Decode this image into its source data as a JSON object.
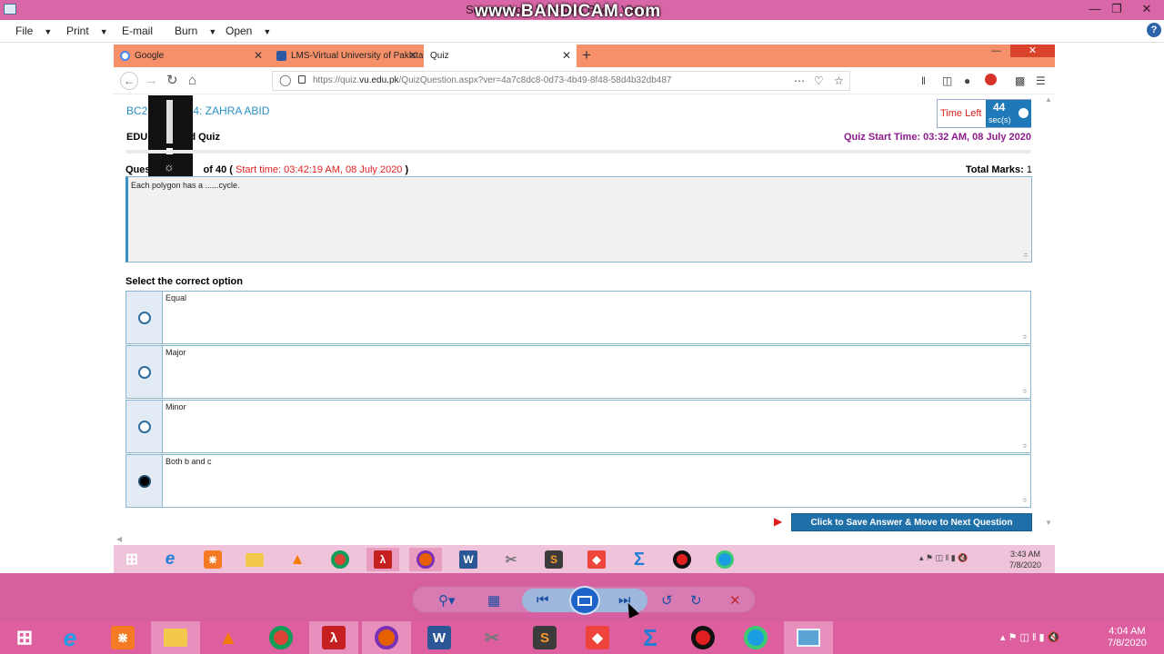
{
  "viewer": {
    "title": "Screenshot - Windows Photo Viewer",
    "watermark": "www.BANDICAM.com",
    "menu": [
      "File",
      "Print",
      "E-mail",
      "Burn",
      "Open"
    ],
    "help_icon": "?"
  },
  "browser": {
    "tabs": [
      {
        "label": "Google",
        "icon": "google-icon"
      },
      {
        "label": "LMS-Virtual University of Pakistan",
        "icon": "lms-icon"
      },
      {
        "label": "Quiz",
        "icon": "none"
      }
    ],
    "url_prefix": "https://quiz.",
    "url_domain": "vu.edu.pk",
    "url_path": "/QuizQuestion.aspx?ver=4a7c8dc8-0d73-4b49-8f48-58d4b32db487"
  },
  "quiz": {
    "student": "BC2",
    "student_name": "4: ZAHRA ABID",
    "course_prefix": "EDU",
    "course_suffix": "ed Quiz",
    "time_left_label": "Time Left",
    "time_left_value": "44",
    "time_left_unit": "sec(s)",
    "start_time": "Quiz Start Time: 03:32 AM, 08 July 2020",
    "question_prefix": "Ques",
    "question_count": "of 40 (",
    "question_start": "Start time: 03:42:19 AM, 08 July 2020",
    "question_suffix": ")",
    "total_marks_label": "Total Marks:",
    "total_marks_value": "1",
    "question_text": "Each polygon has a ......cycle.",
    "select_label": "Select the correct option",
    "options": [
      {
        "text": "Equal",
        "selected": false
      },
      {
        "text": "Major",
        "selected": false
      },
      {
        "text": "Minor",
        "selected": false
      },
      {
        "text": "Both b and c",
        "selected": true
      }
    ],
    "save_button": "Click to Save Answer & Move to Next Question"
  },
  "inner_taskbar": {
    "time": "3:43 AM",
    "date": "7/8/2020",
    "apps": [
      "start-icon",
      "ie-icon",
      "xampp-icon",
      "file-explorer-icon",
      "vlc-icon",
      "chrome-icon",
      "acrobat-icon",
      "firefox-icon",
      "word-icon",
      "snipping-icon",
      "sublime-icon",
      "anydesk-icon",
      "sigma-icon",
      "record-icon",
      "edge-icon"
    ]
  },
  "taskbar": {
    "time": "4:04 AM",
    "date": "7/8/2020",
    "apps": [
      "start-icon",
      "ie-icon",
      "xampp-icon",
      "file-explorer-icon",
      "vlc-icon",
      "chrome-icon",
      "acrobat-icon",
      "firefox-icon",
      "word-icon",
      "snipping-icon",
      "sublime-icon",
      "anydesk-icon",
      "sigma-icon",
      "record-icon",
      "edge-icon",
      "photo-viewer-icon"
    ]
  }
}
